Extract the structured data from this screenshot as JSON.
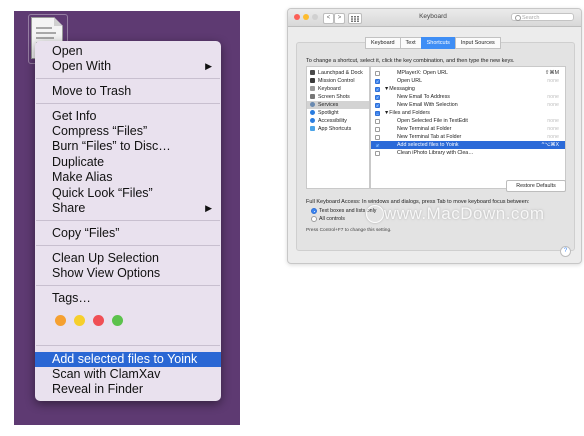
{
  "colors": {
    "desktop": "#5e3a72",
    "menu_bg": "#e9e1ee",
    "highlight": "#2a67d4",
    "tab_active": "#3f8ef5"
  },
  "context_menu": {
    "items": [
      {
        "label": "Open"
      },
      {
        "label": "Open With",
        "submenu": true
      },
      {
        "label": "Move to Trash"
      },
      {
        "label": "Get Info"
      },
      {
        "label": "Compress “Files”"
      },
      {
        "label": "Burn “Files” to Disc…"
      },
      {
        "label": "Duplicate"
      },
      {
        "label": "Make Alias"
      },
      {
        "label": "Quick Look “Files”"
      },
      {
        "label": "Share",
        "submenu": true
      },
      {
        "label": "Copy “Files”"
      },
      {
        "label": "Clean Up Selection"
      },
      {
        "label": "Show View Options"
      },
      {
        "label": "Tags…"
      },
      {
        "label": "Add selected files to Yoink",
        "highlighted": true
      },
      {
        "label": "Scan with ClamXav"
      },
      {
        "label": "Reveal in Finder"
      }
    ],
    "submenu_arrow": "▶",
    "tag_colors": [
      "#f5a030",
      "#f6cf2b",
      "#f04f55",
      "#5cc24c"
    ]
  },
  "keyboard_window": {
    "title": "Keyboard",
    "search_placeholder": "Search",
    "nav_back": "<",
    "nav_forward": ">",
    "grid_icon": "grid-icon",
    "tabs": [
      {
        "label": "Keyboard"
      },
      {
        "label": "Text"
      },
      {
        "label": "Shortcuts",
        "active": true
      },
      {
        "label": "Input Sources"
      }
    ],
    "instructions": "To change a shortcut, select it, click the key combination, and then type the new keys.",
    "categories": [
      {
        "label": "Launchpad & Dock",
        "icon_color": "#4a4a4a"
      },
      {
        "label": "Mission Control",
        "icon_color": "#3a3a3a"
      },
      {
        "label": "Keyboard",
        "icon_color": "#9a9a9a"
      },
      {
        "label": "Screen Shots",
        "icon_color": "#777777"
      },
      {
        "label": "Services",
        "icon_color": "#6a8ab0",
        "selected": true
      },
      {
        "label": "Spotlight",
        "icon_color": "#2a7de0"
      },
      {
        "label": "Accessibility",
        "icon_color": "#2a7de0"
      },
      {
        "label": "App Shortcuts",
        "icon_color": "#4aa3e8"
      }
    ],
    "shortcuts": [
      {
        "label": "MPlayerX: Open URL",
        "checked": false,
        "key": "⇧⌘M",
        "dim": false
      },
      {
        "label": "Open URL",
        "checked": true,
        "key": "none",
        "dim": true
      },
      {
        "label": "▼Messaging",
        "checked": true,
        "group": true,
        "key": ""
      },
      {
        "label": "New Email To Address",
        "checked": true,
        "key": "none",
        "dim": true
      },
      {
        "label": "New Email With Selection",
        "checked": true,
        "key": "none",
        "dim": true
      },
      {
        "label": "▼Files and Folders",
        "checked": "mixed",
        "group": true,
        "key": ""
      },
      {
        "label": "Open Selected File in TextEdit",
        "checked": false,
        "key": "none",
        "dim": true
      },
      {
        "label": "New Terminal at Folder",
        "checked": false,
        "key": "none",
        "dim": true
      },
      {
        "label": "New Terminal Tab at Folder",
        "checked": false,
        "key": "none",
        "dim": true
      },
      {
        "label": "Add selected files to Yoink",
        "checked": true,
        "key": "^⌥⌘X",
        "highlighted": true
      },
      {
        "label": "Clean iPhoto Library with Clea…",
        "checked": false,
        "key": "",
        "dim": true
      }
    ],
    "restore_button": "Restore Defaults",
    "full_keyboard_access": "Full Keyboard Access: In windows and dialogs, press Tab to move keyboard focus between:",
    "radio_options": [
      {
        "label": "Text boxes and lists only",
        "selected": true
      },
      {
        "label": "All controls",
        "selected": false
      }
    ],
    "hint": "Press Control+F7 to change this setting.",
    "help": "?"
  },
  "watermark": {
    "text": "www.MacDown.com"
  }
}
